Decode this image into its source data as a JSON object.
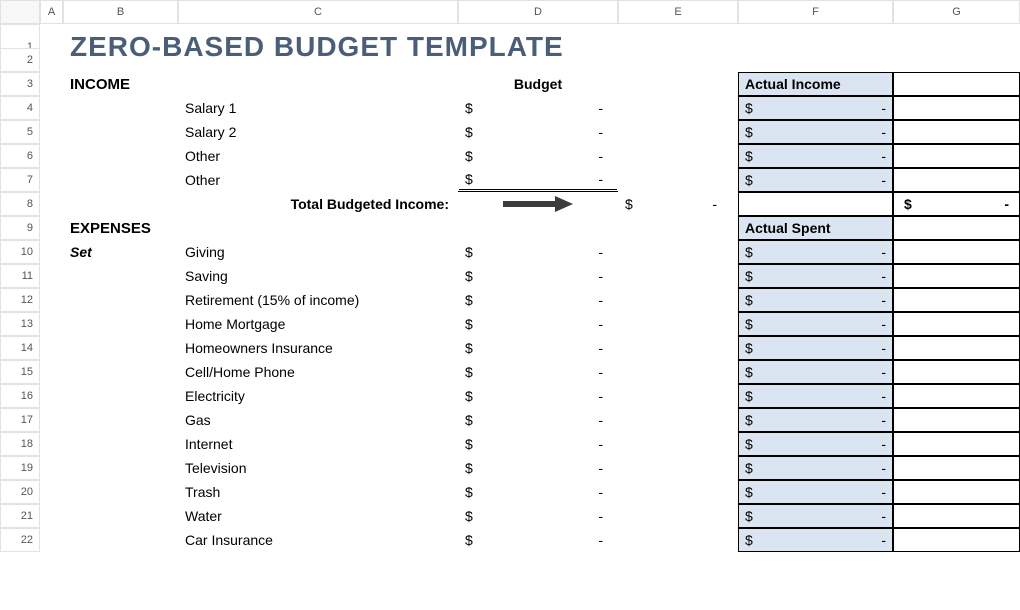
{
  "title": "ZERO-BASED BUDGET TEMPLATE",
  "columns": [
    "A",
    "B",
    "C",
    "D",
    "E",
    "F",
    "G"
  ],
  "rows": [
    "1",
    "2",
    "3",
    "4",
    "5",
    "6",
    "7",
    "8",
    "9",
    "10",
    "11",
    "12",
    "13",
    "14",
    "15",
    "16",
    "17",
    "18",
    "19",
    "20",
    "21",
    "22"
  ],
  "headers": {
    "income": "INCOME",
    "budget": "Budget",
    "expenses": "EXPENSES",
    "set": "Set",
    "actual_income": "Actual Income",
    "actual_spent": "Actual Spent",
    "total_budgeted_income": "Total Budgeted Income:"
  },
  "currency": "$",
  "dash": "-",
  "income_items": [
    "Salary 1",
    "Salary 2",
    "Other",
    "Other"
  ],
  "expense_items": [
    "Giving",
    "Saving",
    "Retirement (15% of income)",
    "Home Mortgage",
    "Homeowners Insurance",
    "Cell/Home Phone",
    "Electricity",
    "Gas",
    "Internet",
    "Television",
    "Trash",
    "Water",
    "Car Insurance"
  ],
  "colors": {
    "title": "#4a5d79",
    "blue_fill": "#dbe5f1"
  }
}
